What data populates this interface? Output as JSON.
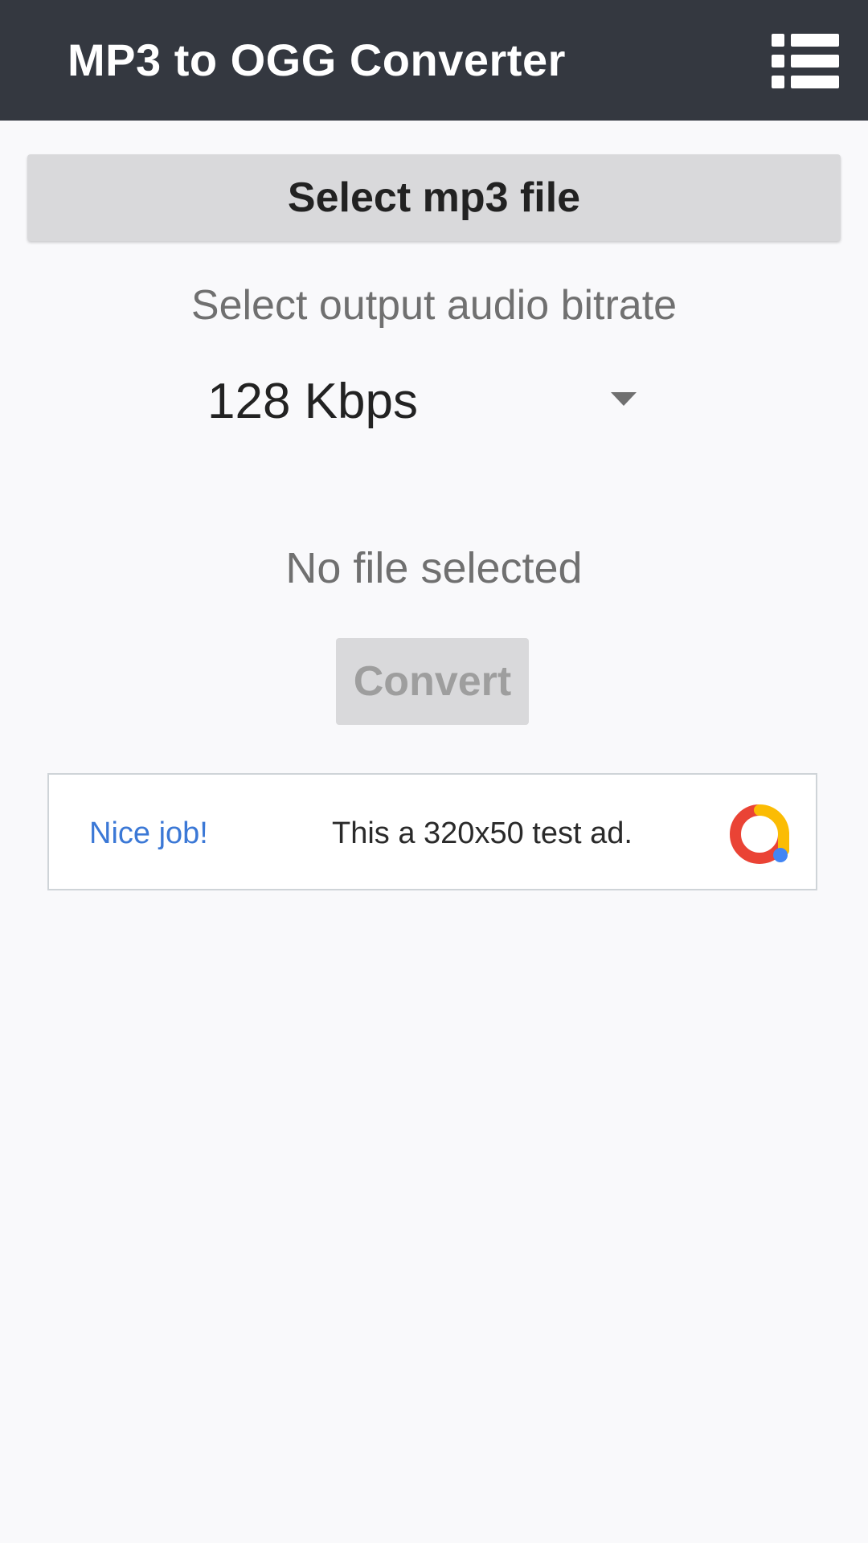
{
  "appbar": {
    "title": "MP3 to OGG Converter",
    "menu_icon": "list-menu-icon",
    "background": "#343840"
  },
  "main": {
    "select_file_label": "Select mp3 file",
    "bitrate_label": "Select output audio bitrate",
    "bitrate_value": "128 Kbps",
    "status_text": "No file selected",
    "convert_label": "Convert"
  },
  "ad": {
    "left_text": "Nice job!",
    "body_text": "This a 320x50 test ad.",
    "logo_icon": "ads-logo-icon",
    "accent": "#3b78d6"
  }
}
